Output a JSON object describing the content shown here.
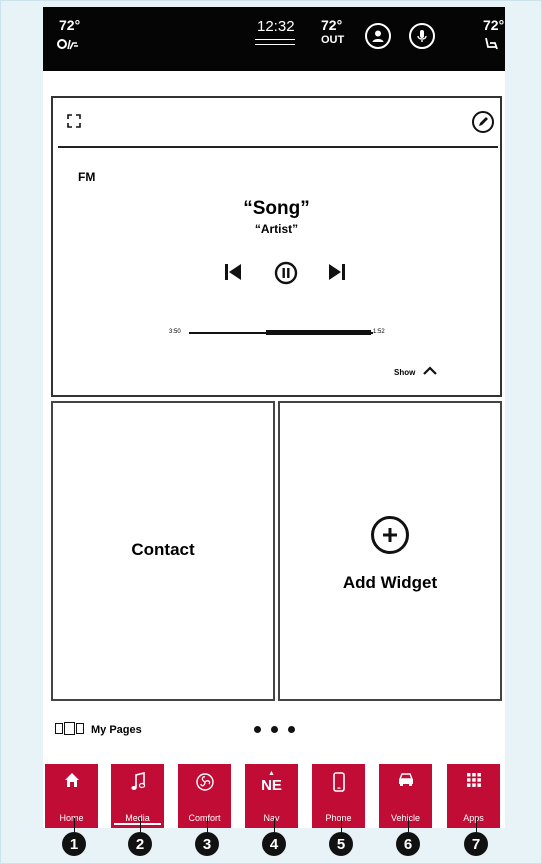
{
  "status_bar": {
    "driver_temp": "72°",
    "clock": "12:32",
    "outside_temp": "72°",
    "outside_label": "OUT",
    "passenger_temp": "72°",
    "profile_icon": "profile-icon",
    "mic_icon": "microphone-icon"
  },
  "media": {
    "band": "FM",
    "song": "“Song”",
    "artist": "“Artist”",
    "time_elapsed": "3:50",
    "time_remaining": "1:52",
    "progress": 0.42,
    "show_label": "Show",
    "controls": [
      "previous-icon",
      "pause-icon",
      "next-icon"
    ]
  },
  "tiles": {
    "contact_label": "Contact",
    "add_widget_label": "Add Widget"
  },
  "pages": {
    "label": "My Pages",
    "page_count": 3
  },
  "nav": {
    "items": [
      {
        "label": "Home",
        "icon": "home-icon"
      },
      {
        "label": "Media",
        "icon": "music-note-icon",
        "active": true
      },
      {
        "label": "Comfort",
        "icon": "fan-icon"
      },
      {
        "label": "Nav",
        "icon": "compass-icon",
        "heading": "NE"
      },
      {
        "label": "Phone",
        "icon": "phone-icon"
      },
      {
        "label": "Vehicle",
        "icon": "car-icon"
      },
      {
        "label": "Apps",
        "icon": "apps-grid-icon"
      }
    ]
  },
  "callouts": [
    "1",
    "2",
    "3",
    "4",
    "5",
    "6",
    "7"
  ],
  "colors": {
    "accent": "#c10d36",
    "status_bar": "#050505",
    "background": "#e8f3f7"
  }
}
